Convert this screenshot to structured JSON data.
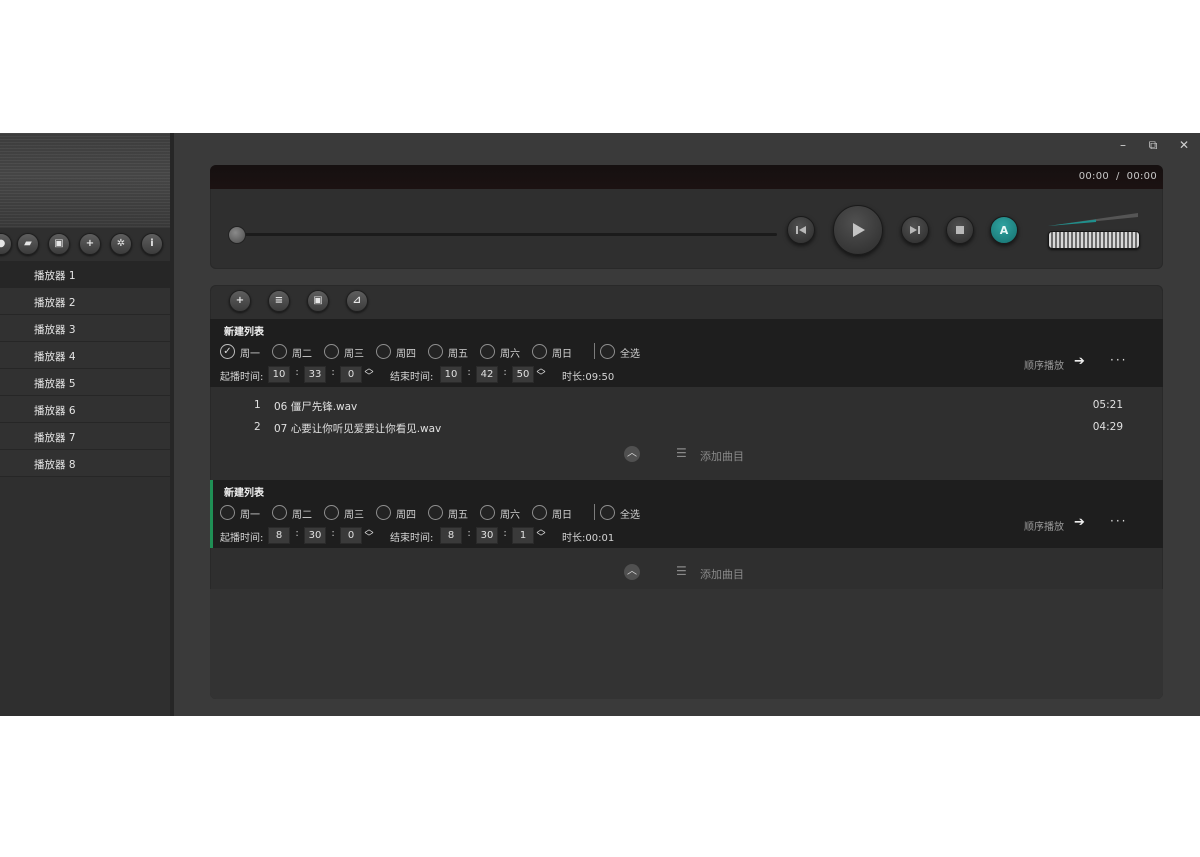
{
  "window": {
    "minimize": "–",
    "restore": "⧉",
    "close": "✕"
  },
  "sidebar": {
    "toolbar_icons": [
      "record-icon",
      "folder-open-icon",
      "save-icon",
      "add-icon",
      "settings-icon",
      "info-icon"
    ],
    "players": [
      "播放器 1",
      "播放器 2",
      "播放器 3",
      "播放器 4",
      "播放器 5",
      "播放器 6",
      "播放器 7",
      "播放器 8"
    ],
    "active_index": 0
  },
  "transport": {
    "time_current": "00:00",
    "time_separator": "/",
    "time_total": "00:00",
    "seek_progress": 0,
    "ab_label": "A",
    "accent_color": "#1f8f8c"
  },
  "playlist_toolbar": [
    "add-icon",
    "import-icon",
    "save-icon",
    "clear-icon"
  ],
  "playlists": [
    {
      "title": "新建列表",
      "days": [
        {
          "label": "周一",
          "checked": true
        },
        {
          "label": "周二",
          "checked": false
        },
        {
          "label": "周三",
          "checked": false
        },
        {
          "label": "周四",
          "checked": false
        },
        {
          "label": "周五",
          "checked": false
        },
        {
          "label": "周六",
          "checked": false
        },
        {
          "label": "周日",
          "checked": false
        }
      ],
      "select_all": "全选",
      "start_label": "起播时间:",
      "start": [
        "10",
        "33",
        "0"
      ],
      "end_label": "结束时间:",
      "end": [
        "10",
        "42",
        "50"
      ],
      "duration": "时长:09:50",
      "order": "顺序播放",
      "more": "···",
      "tracks": [
        {
          "no": "1",
          "title": "06 僵尸先锋.wav",
          "duration": "05:21"
        },
        {
          "no": "2",
          "title": "07 心要让你听见爱要让你看见.wav",
          "duration": "04:29"
        }
      ],
      "add_label": "添加曲目"
    },
    {
      "title": "新建列表",
      "days": [
        {
          "label": "周一",
          "checked": false
        },
        {
          "label": "周二",
          "checked": false
        },
        {
          "label": "周三",
          "checked": false
        },
        {
          "label": "周四",
          "checked": false
        },
        {
          "label": "周五",
          "checked": false
        },
        {
          "label": "周六",
          "checked": false
        },
        {
          "label": "周日",
          "checked": false
        }
      ],
      "select_all": "全选",
      "start_label": "起播时间:",
      "start": [
        "8",
        "30",
        "0"
      ],
      "end_label": "结束时间:",
      "end": [
        "8",
        "30",
        "1"
      ],
      "duration": "时长:00:01",
      "order": "顺序播放",
      "more": "···",
      "tracks": [],
      "add_label": "添加曲目"
    }
  ]
}
